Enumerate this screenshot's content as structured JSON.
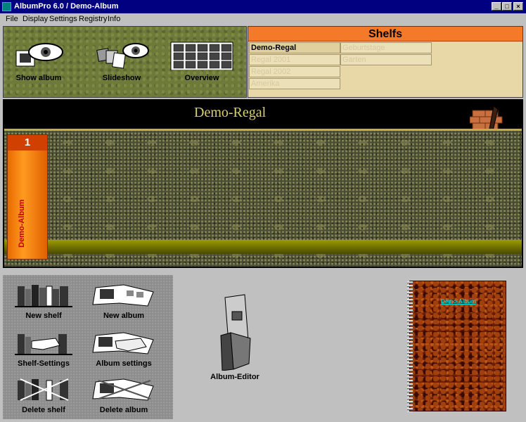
{
  "window": {
    "title": "AlbumPro 6.0 / Demo-Album",
    "minimize": "_",
    "maximize": "□",
    "close": "×"
  },
  "menu": [
    "File",
    "Display",
    "Settings",
    "Registry",
    "Info"
  ],
  "tools": {
    "show_album": "Show album",
    "slideshow": "Slideshow",
    "overview": "Overview"
  },
  "shelves": {
    "header": "Shelfs",
    "col1": [
      "Demo-Regal",
      "Regal 2001",
      "Regal 2002",
      "Amerika"
    ],
    "col2": [
      "Geburtstage",
      "Garten"
    ]
  },
  "shelf": {
    "title": "Demo-Regal",
    "book_number": "1",
    "book_title": "Demo-Album"
  },
  "bottom_tools": {
    "new_shelf": "New shelf",
    "new_album": "New album",
    "shelf_settings": "Shelf-Settings",
    "album_settings": "Album settings",
    "delete_shelf": "Delete shelf",
    "delete_album": "Delete album",
    "album_editor": "Album-Editor"
  },
  "album_cover": {
    "title": "Demo-Album"
  },
  "colors": {
    "title_bar": "#000080",
    "shelves_header": "#f47a2a",
    "book": "#ff8a10",
    "album_cover": "#6a1c08"
  }
}
